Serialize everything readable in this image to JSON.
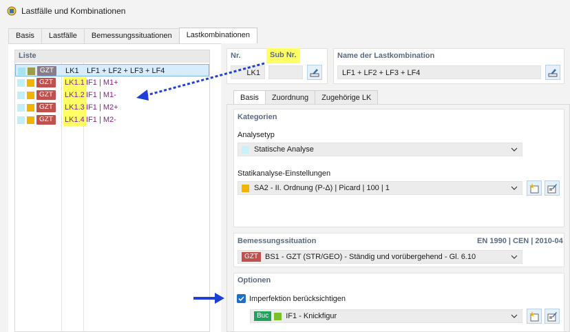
{
  "window": {
    "title": "Lastfälle und Kombinationen"
  },
  "top_tabs": [
    "Basis",
    "Lastfälle",
    "Bemessungssituationen",
    "Lastkombinationen"
  ],
  "list": {
    "header": "Liste",
    "rows": [
      {
        "badge": "GZT",
        "no": "LK1",
        "desc": "LF1 + LF2 + LF3 + LF4"
      },
      {
        "badge": "GZT",
        "no": "LK1.1",
        "desc": "IF1 | M1+"
      },
      {
        "badge": "GZT",
        "no": "LK1.2",
        "desc": "IF1 | M1-"
      },
      {
        "badge": "GZT",
        "no": "LK1.3",
        "desc": "IF1 | M2+"
      },
      {
        "badge": "GZT",
        "no": "LK1.4",
        "desc": "IF1 | M2-"
      }
    ]
  },
  "header_fields": {
    "nr_label": "Nr.",
    "sub_nr_label": "Sub Nr.",
    "nr_value": "LK1",
    "sub_nr_value": "",
    "name_label": "Name der Lastkombination",
    "name_value": "LF1 + LF2 + LF3 + LF4"
  },
  "inner_tabs": [
    "Basis",
    "Zuordnung",
    "Zugehörige LK"
  ],
  "kategorien": {
    "title": "Kategorien",
    "analysetyp_label": "Analysetyp",
    "analysetyp_value": "Statische Analyse",
    "statik_label": "Statikanalyse-Einstellungen",
    "statik_value": "SA2 - II. Ordnung (P-Δ) | Picard | 100 | 1"
  },
  "bemessung": {
    "title": "Bemessungssituation",
    "norm": "EN 1990 | CEN | 2010-04",
    "badge": "GZT",
    "value": "BS1 - GZT (STR/GEO) - Ständig und vorübergehend - Gl. 6.10"
  },
  "optionen": {
    "title": "Optionen",
    "checkbox_label": "Imperfektion berücksichtigen",
    "checked": true,
    "imp_badge": "Buc",
    "imp_value": "IF1 - Knickfigur"
  },
  "colors": {
    "gzt_badge": "#c0504d",
    "buc_badge": "#1fa35b",
    "highlight": "#ffff66",
    "arrow": "#1f3fd9",
    "accent_purple": "#8a1e8a"
  }
}
